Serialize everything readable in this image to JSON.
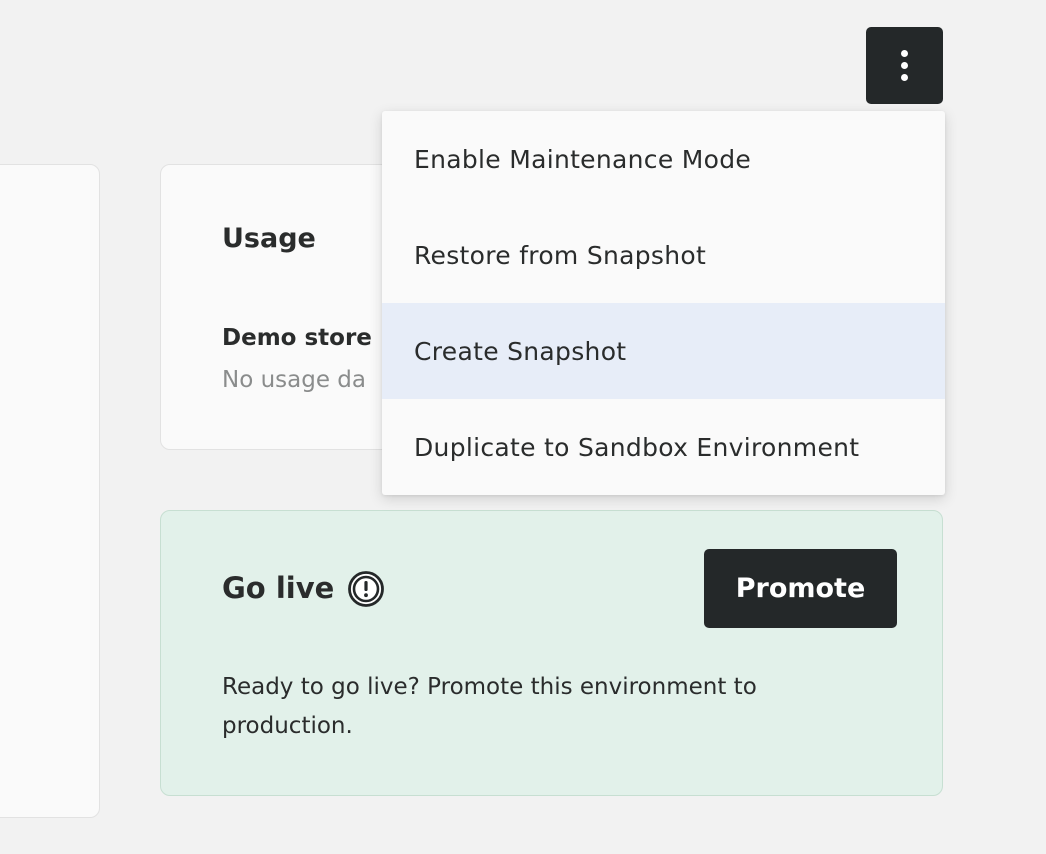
{
  "toolbar": {
    "more_icon": "more-vertical-icon"
  },
  "usage": {
    "title": "Usage",
    "subtitle": "Demo store I",
    "empty_text": "No usage da"
  },
  "go_live": {
    "title": "Go live",
    "warning_icon": "exclamation-circle-icon",
    "promote_label": "Promote",
    "description": "Ready to go live? Promote this environment to production."
  },
  "menu": {
    "items": [
      {
        "label": "Enable Maintenance Mode"
      },
      {
        "label": "Restore from Snapshot"
      },
      {
        "label": "Create Snapshot"
      },
      {
        "label": "Duplicate to Sandbox Environment"
      }
    ],
    "highlighted_index": 2,
    "highlight_color": "#e7edf8"
  },
  "colors": {
    "background": "#f2f2f2",
    "dark_button": "#242829",
    "go_live_bg": "#e2f1ea"
  }
}
